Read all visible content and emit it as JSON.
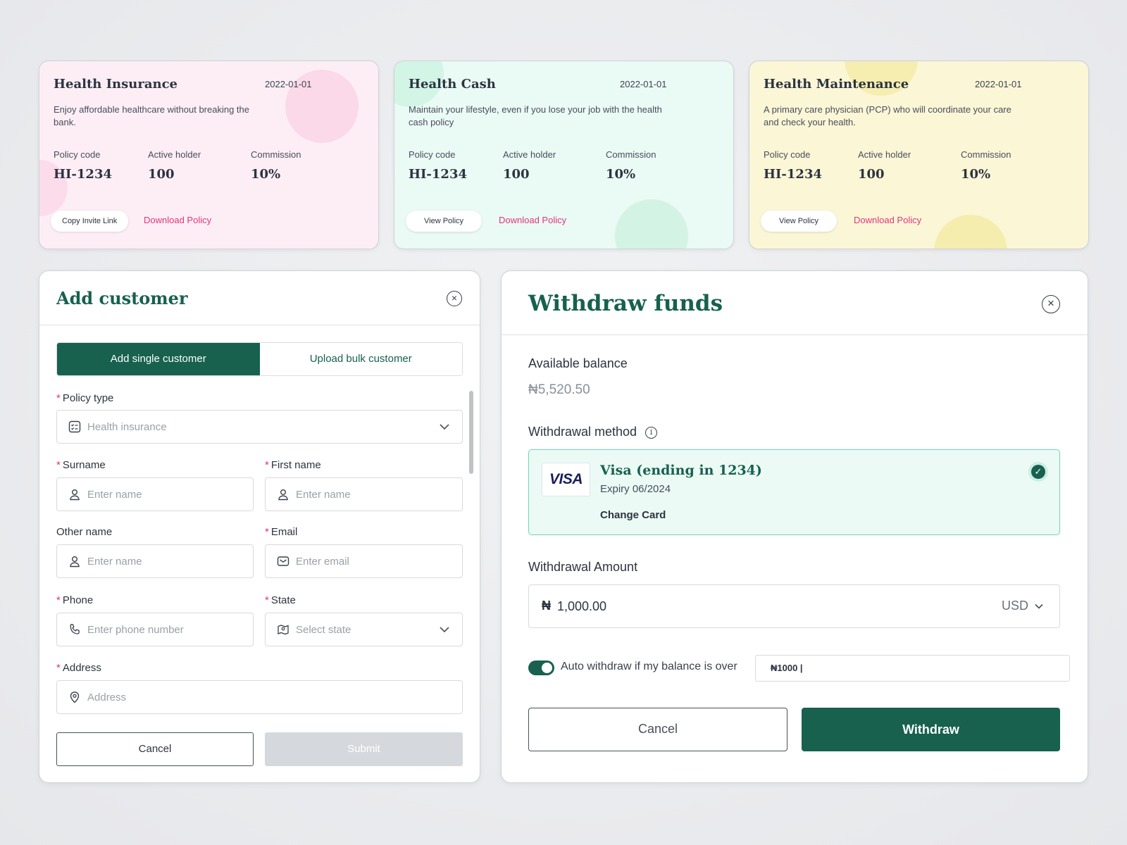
{
  "policy_cards": [
    {
      "title": "Health Insurance",
      "date": "2022-01-01",
      "description": "Enjoy affordable healthcare without breaking the bank.",
      "stats": [
        {
          "label": "Policy code",
          "value": "HI-1234"
        },
        {
          "label": "Active holder",
          "value": "100"
        },
        {
          "label": "Commission",
          "value": "10%"
        }
      ],
      "primary_action": "Copy Invite Link",
      "secondary_action": "Download Policy",
      "background": "#fdeef5"
    },
    {
      "title": "Health Cash",
      "date": "2022-01-01",
      "description": "Maintain your lifestyle, even if you lose your job with the health cash policy",
      "stats": [
        {
          "label": "Policy code",
          "value": "HI-1234"
        },
        {
          "label": "Active holder",
          "value": "100"
        },
        {
          "label": "Commission",
          "value": "10%"
        }
      ],
      "primary_action": "View Policy",
      "secondary_action": "Download Policy",
      "background": "#eafaf4"
    },
    {
      "title": "Health Maintenance",
      "date": "2022-01-01",
      "description": "A primary care physician (PCP) who will coordinate your care and check your health.",
      "stats": [
        {
          "label": "Policy code",
          "value": "HI-1234"
        },
        {
          "label": "Active holder",
          "value": "100"
        },
        {
          "label": "Commission",
          "value": "10%"
        }
      ],
      "primary_action": "View Policy",
      "secondary_action": "Download Policy",
      "background": "#fbf6d6"
    }
  ],
  "add_customer": {
    "title": "Add customer",
    "tabs": {
      "single": "Add single customer",
      "bulk": "Upload bulk customer"
    },
    "policy_type": {
      "label": "Policy type",
      "value": "Health insurance"
    },
    "surname": {
      "label": "Surname",
      "placeholder": "Enter name"
    },
    "first_name": {
      "label": "First name",
      "placeholder": "Enter name"
    },
    "other_name": {
      "label": "Other name",
      "placeholder": "Enter name"
    },
    "email": {
      "label": "Email",
      "placeholder": "Enter email"
    },
    "phone": {
      "label": "Phone",
      "placeholder": "Enter phone number"
    },
    "state": {
      "label": "State",
      "placeholder": "Select state"
    },
    "address": {
      "label": "Address",
      "placeholder": "Address"
    },
    "required_mark": "*",
    "cancel_label": "Cancel",
    "submit_label": "Submit"
  },
  "withdraw": {
    "title": "Withdraw funds",
    "balance_label": "Available balance",
    "balance_value": "₦5,520.50",
    "method_label": "Withdrawal method",
    "card": {
      "brand": "VISA",
      "name": "Visa (ending in 1234)",
      "expiry": "Expiry 06/2024",
      "change_label": "Change Card"
    },
    "amount_label": "Withdrawal Amount",
    "amount_symbol": "₦",
    "amount_value": "1,000.00",
    "currency": "USD",
    "auto_withdraw_label": "Auto withdraw if my balance is over",
    "auto_withdraw_value": "₦1000 |",
    "auto_withdraw_enabled": true,
    "cancel_label": "Cancel",
    "submit_label": "Withdraw"
  },
  "colors": {
    "brand_green": "#17614e",
    "accent_pink": "#e2357d",
    "card_pink": "#fdeef5",
    "card_green": "#eafaf4",
    "card_yellow": "#fbf6d6"
  }
}
